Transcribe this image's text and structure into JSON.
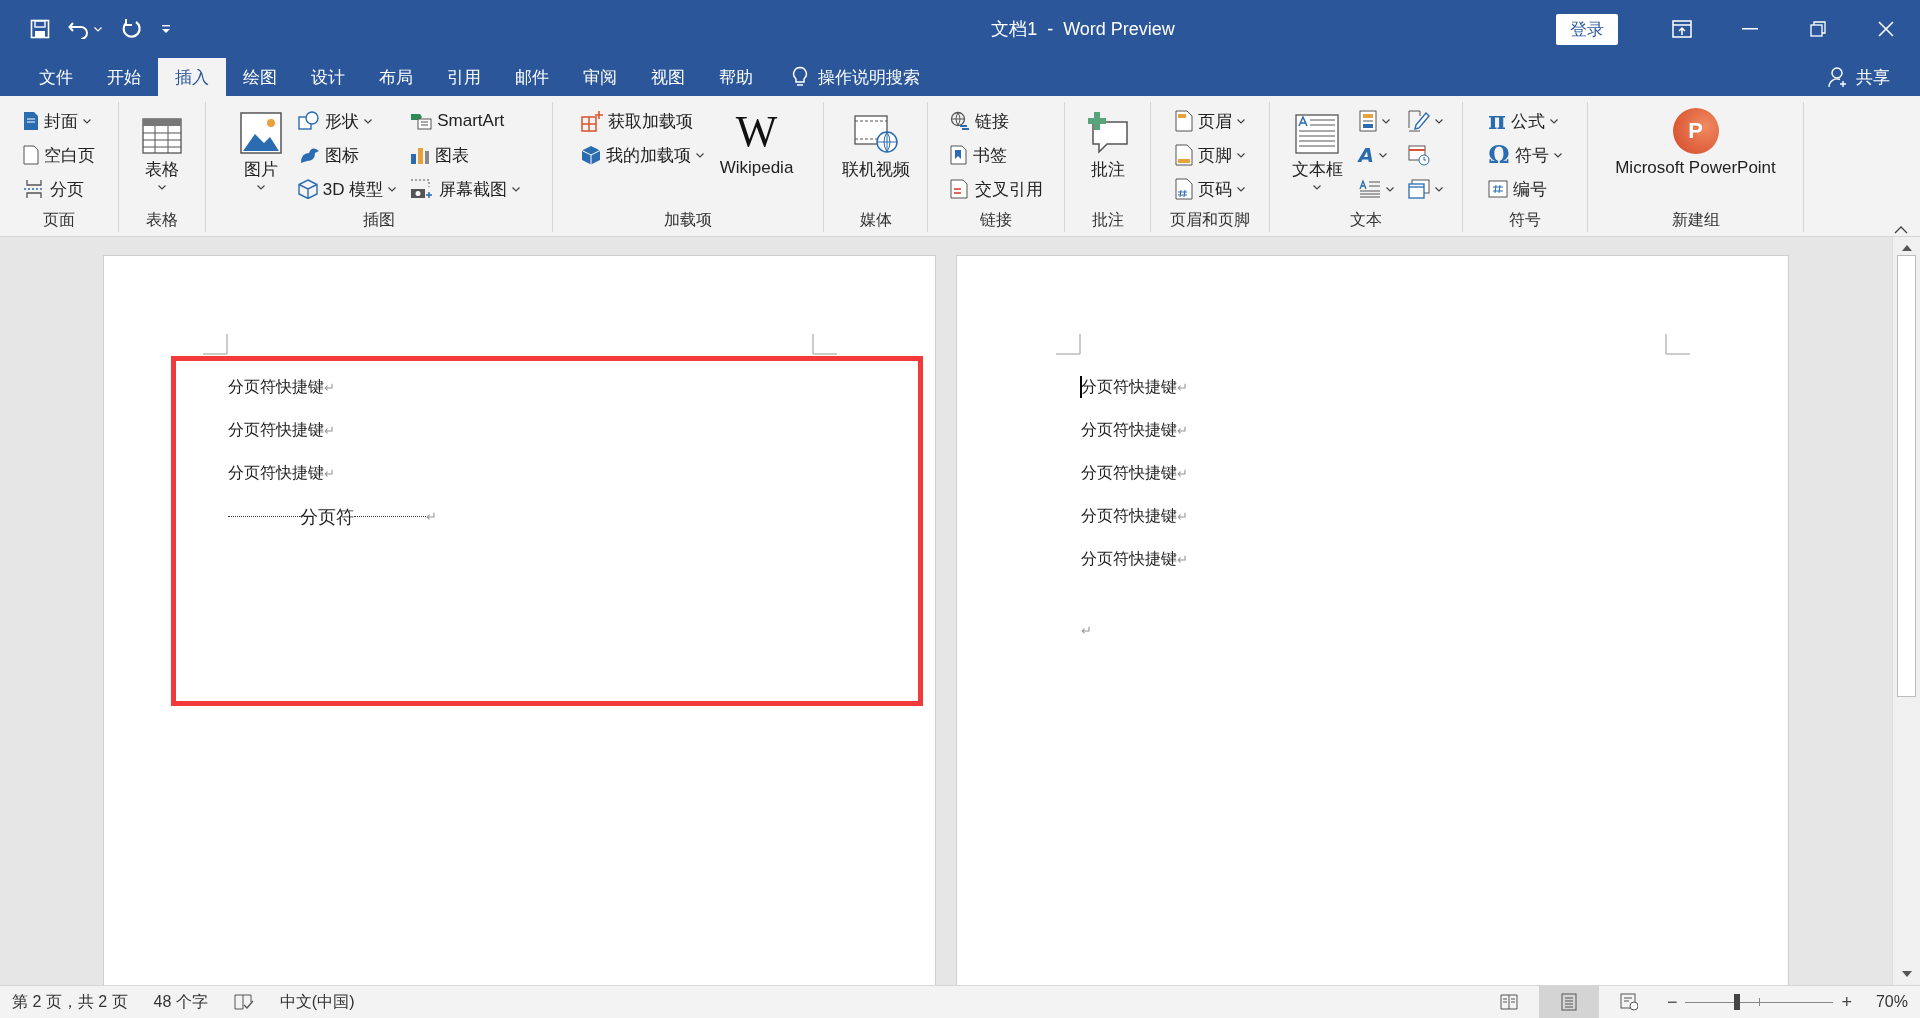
{
  "window": {
    "title": "文档1  -  Word Preview",
    "sign_in": "登录"
  },
  "tabs": [
    {
      "label": "文件",
      "selected": false
    },
    {
      "label": "开始",
      "selected": false
    },
    {
      "label": "插入",
      "selected": true
    },
    {
      "label": "绘图",
      "selected": false
    },
    {
      "label": "设计",
      "selected": false
    },
    {
      "label": "布局",
      "selected": false
    },
    {
      "label": "引用",
      "selected": false
    },
    {
      "label": "邮件",
      "selected": false
    },
    {
      "label": "审阅",
      "selected": false
    },
    {
      "label": "视图",
      "selected": false
    },
    {
      "label": "帮助",
      "selected": false
    }
  ],
  "tell_me": "操作说明搜索",
  "share": "共享",
  "ribbon": {
    "groups": [
      {
        "label": "页面",
        "columns": [
          {
            "kind": "stack",
            "items": [
              {
                "label": "封面",
                "dropdown": true
              },
              {
                "label": "空白页",
                "dropdown": false
              },
              {
                "label": "分页",
                "dropdown": false
              }
            ]
          }
        ]
      },
      {
        "label": "表格",
        "columns": [
          {
            "kind": "large",
            "items": [
              {
                "label": "表格",
                "dropdown": true
              }
            ]
          }
        ]
      },
      {
        "label": "插图",
        "columns": [
          {
            "kind": "large",
            "items": [
              {
                "label": "图片",
                "dropdown": true
              }
            ]
          },
          {
            "kind": "stack",
            "items": [
              {
                "label": "形状",
                "dropdown": true
              },
              {
                "label": "图标",
                "dropdown": false
              },
              {
                "label": "3D 模型",
                "dropdown": true
              }
            ]
          },
          {
            "kind": "stack",
            "items": [
              {
                "label": "SmartArt",
                "dropdown": false
              },
              {
                "label": "图表",
                "dropdown": false
              },
              {
                "label": "屏幕截图",
                "dropdown": true
              }
            ]
          }
        ]
      },
      {
        "label": "加载项",
        "columns": [
          {
            "kind": "stack",
            "items": [
              {
                "label": "获取加载项",
                "dropdown": false
              },
              {
                "label": "我的加载项",
                "dropdown": true
              }
            ]
          },
          {
            "kind": "large",
            "items": [
              {
                "label": "Wikipedia",
                "glyph": "W",
                "dropdown": false
              }
            ]
          }
        ]
      },
      {
        "label": "媒体",
        "columns": [
          {
            "kind": "large",
            "items": [
              {
                "label": "联机视频",
                "dropdown": false
              }
            ]
          }
        ]
      },
      {
        "label": "链接",
        "columns": [
          {
            "kind": "stack",
            "items": [
              {
                "label": "链接",
                "dropdown": false
              },
              {
                "label": "书签",
                "dropdown": false
              },
              {
                "label": "交叉引用",
                "dropdown": false
              }
            ]
          }
        ]
      },
      {
        "label": "批注",
        "columns": [
          {
            "kind": "large",
            "items": [
              {
                "label": "批注",
                "dropdown": false
              }
            ]
          }
        ]
      },
      {
        "label": "页眉和页脚",
        "columns": [
          {
            "kind": "stack",
            "items": [
              {
                "label": "页眉",
                "dropdown": true
              },
              {
                "label": "页脚",
                "dropdown": true
              },
              {
                "label": "页码",
                "dropdown": true
              }
            ]
          }
        ]
      },
      {
        "label": "文本",
        "columns": [
          {
            "kind": "large",
            "items": [
              {
                "label": "文本框",
                "dropdown": true
              }
            ]
          },
          {
            "kind": "stack",
            "items": [
              {
                "dropdown": true
              },
              {
                "glyph": "A",
                "dropdown": true
              },
              {
                "dropdown": true
              }
            ]
          },
          {
            "kind": "stack",
            "items": [
              {
                "dropdown": true
              },
              {
                "dropdown": false
              },
              {
                "dropdown": true
              }
            ]
          }
        ]
      },
      {
        "label": "符号",
        "columns": [
          {
            "kind": "stack",
            "items": [
              {
                "label": "公式",
                "glyph": "π",
                "dropdown": true
              },
              {
                "label": "符号",
                "glyph": "Ω",
                "dropdown": true
              },
              {
                "label": "编号",
                "dropdown": false
              }
            ]
          }
        ]
      },
      {
        "label": "新建组",
        "columns": [
          {
            "kind": "large",
            "items": [
              {
                "label": "Microsoft PowerPoint",
                "glyph": "P",
                "dropdown": false
              }
            ]
          }
        ]
      }
    ]
  },
  "pages": [
    {
      "highlight": true,
      "paragraphs": [
        {
          "kind": "text",
          "text": "分页符快捷键",
          "mark": "↵",
          "caret": false
        },
        {
          "kind": "text",
          "text": "分页符快捷键",
          "mark": "↵",
          "caret": false
        },
        {
          "kind": "text",
          "text": "分页符快捷键",
          "mark": "↵",
          "caret": false
        },
        {
          "kind": "page-break",
          "text": "分页符",
          "mark": "↵",
          "caret": false
        }
      ]
    },
    {
      "highlight": false,
      "paragraphs": [
        {
          "kind": "text",
          "text": "分页符快捷键",
          "mark": "↵",
          "caret": true
        },
        {
          "kind": "text",
          "text": "分页符快捷键",
          "mark": "↵",
          "caret": false
        },
        {
          "kind": "text",
          "text": "分页符快捷键",
          "mark": "↵",
          "caret": false
        },
        {
          "kind": "text",
          "text": "分页符快捷键",
          "mark": "↵",
          "caret": false
        },
        {
          "kind": "text",
          "text": "分页符快捷键",
          "mark": "↵",
          "caret": false
        },
        {
          "kind": "empty",
          "mark": "↵",
          "caret": false
        }
      ]
    }
  ],
  "status_bar": {
    "page": "第 2 页，共 2 页",
    "words": "48 个字",
    "language": "中文(中国)",
    "views": [
      {
        "selected": false
      },
      {
        "selected": true
      },
      {
        "selected": false
      }
    ],
    "zoom": {
      "minus": "−",
      "plus": "+",
      "level": 0.34,
      "reading": "70%"
    }
  }
}
